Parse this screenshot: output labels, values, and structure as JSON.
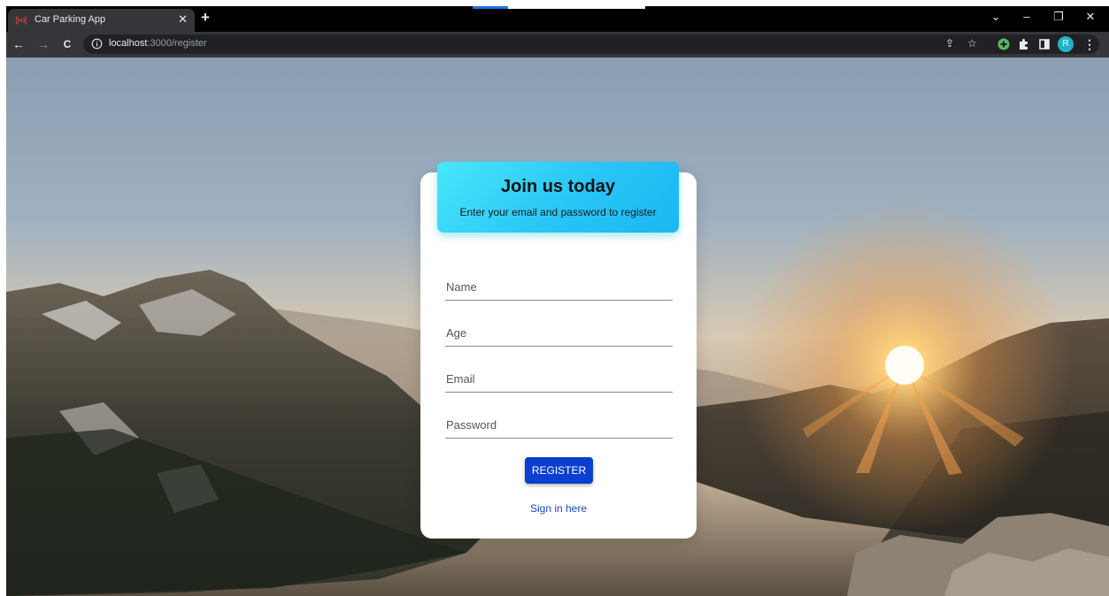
{
  "browser": {
    "tab": {
      "title": "Car Parking App",
      "close_glyph": "✕",
      "favicon": "radio-waves-icon"
    },
    "new_tab_glyph": "+",
    "window_controls": {
      "tablist": "⌄",
      "minimize": "–",
      "maximize": "❐",
      "close": "✕"
    },
    "nav": {
      "back": "←",
      "forward": "→",
      "reload": "C"
    },
    "address": {
      "host": "localhost",
      "path": ":3000/register"
    },
    "profile_initial": "R",
    "menu_glyph": "⋮",
    "share_glyph": "⇪",
    "bookmark_glyph": "☆"
  },
  "form": {
    "title": "Join us today",
    "subtitle": "Enter your email and password to register",
    "fields": {
      "name": {
        "placeholder": "Name",
        "value": ""
      },
      "age": {
        "placeholder": "Age",
        "value": ""
      },
      "email": {
        "placeholder": "Email",
        "value": ""
      },
      "password": {
        "placeholder": "Password",
        "value": ""
      }
    },
    "register_label": "REGISTER",
    "signin_label": "Sign in here"
  },
  "colors": {
    "header_gradient_start": "#49e6fb",
    "header_gradient_end": "#1ab8f2",
    "register_button": "#0b3fd0",
    "link": "#1a47c8"
  }
}
